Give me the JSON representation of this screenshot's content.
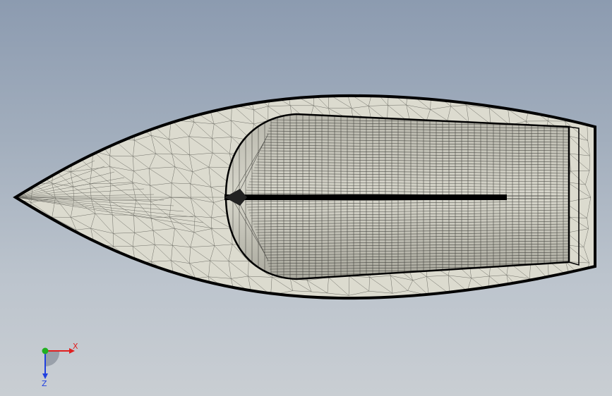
{
  "triad": {
    "x_label": "X",
    "y_label": "",
    "z_label": "Z",
    "colors": {
      "x": "#e02020",
      "y": "#20b020",
      "z": "#2040e0"
    }
  },
  "model": {
    "shaded_color": "#dcdbcf",
    "edge_color": "#000000",
    "background_top": "#8c9bb0",
    "background_bottom": "#c9ced3"
  }
}
